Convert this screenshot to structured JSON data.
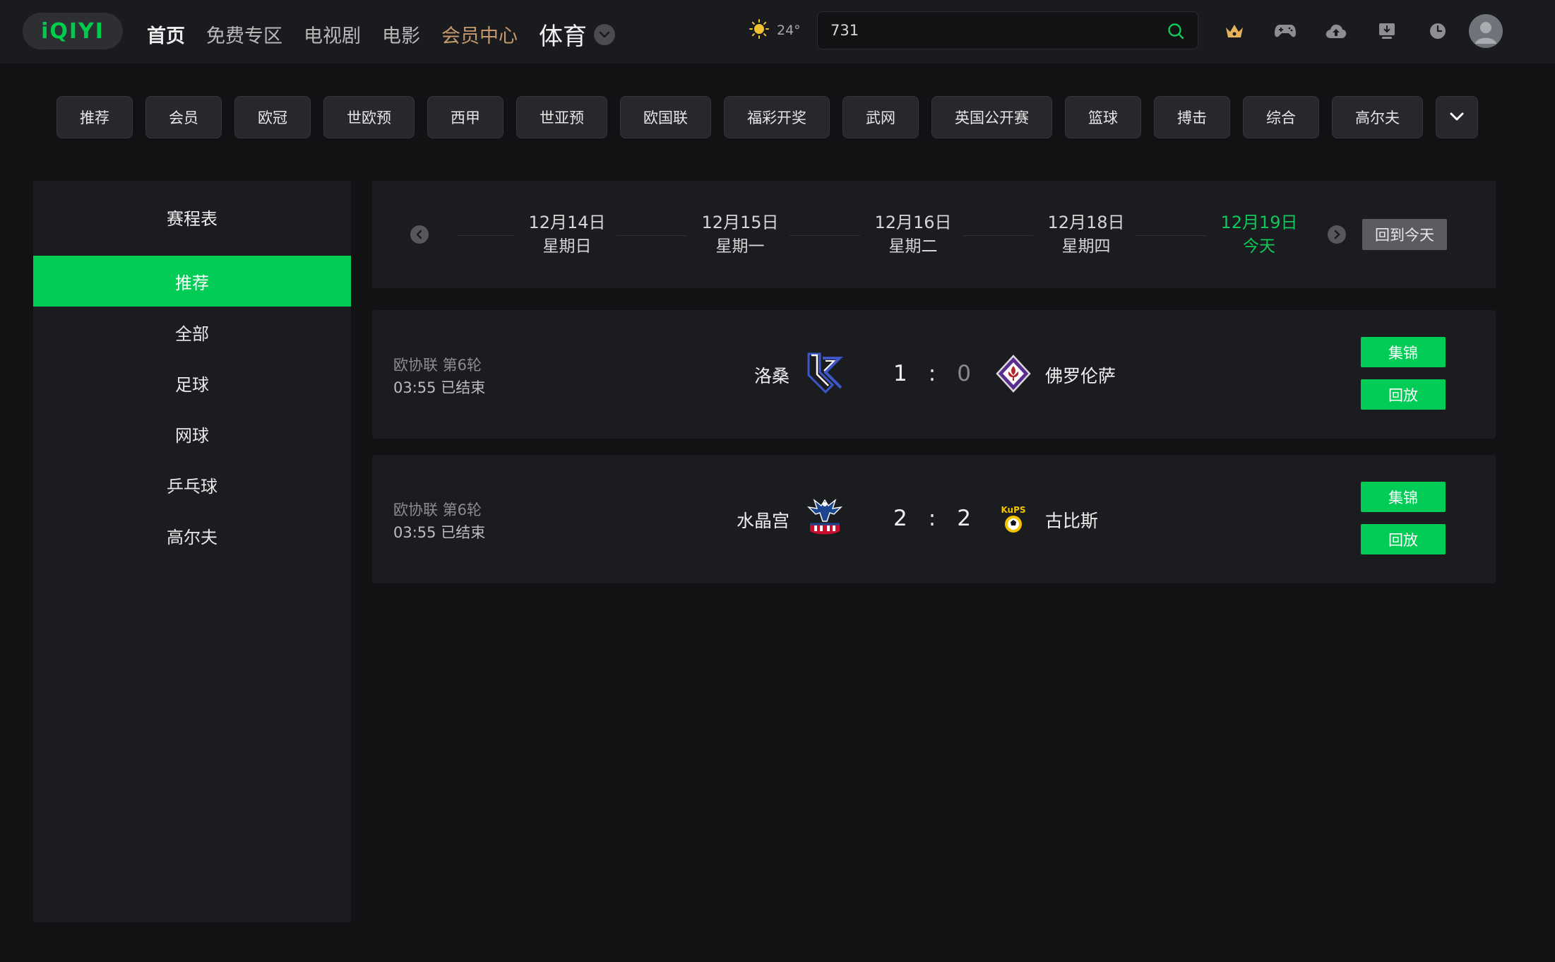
{
  "header": {
    "logo_text": "iQIYI",
    "nav": [
      {
        "label": "首页"
      },
      {
        "label": "免费专区"
      },
      {
        "label": "电视剧"
      },
      {
        "label": "电影"
      },
      {
        "label": "会员中心"
      },
      {
        "label": "体育"
      }
    ],
    "weather": {
      "temp": "24°",
      "icon": "sun-icon"
    },
    "search": {
      "value": "731",
      "icon": "search-icon"
    },
    "tool_icons": [
      "vip-crown-icon",
      "gamepad-icon",
      "cloud-upload-icon",
      "download-icon",
      "history-clock-icon"
    ],
    "accent_color": "#00cc56",
    "vip_color": "#c49a6c"
  },
  "categories": [
    "推荐",
    "会员",
    "欧冠",
    "世欧预",
    "西甲",
    "世亚预",
    "欧国联",
    "福彩开奖",
    "武网",
    "英国公开赛",
    "篮球",
    "搏击",
    "综合",
    "高尔夫"
  ],
  "sidebar": {
    "title": "赛程表",
    "items": [
      "推荐",
      "全部",
      "足球",
      "网球",
      "乒乓球",
      "高尔夫"
    ],
    "active_index": 0
  },
  "datebar": {
    "days": [
      {
        "date": "12月14日",
        "weekday": "星期日"
      },
      {
        "date": "12月15日",
        "weekday": "星期一"
      },
      {
        "date": "12月16日",
        "weekday": "星期二"
      },
      {
        "date": "12月18日",
        "weekday": "星期四"
      },
      {
        "date": "12月19日",
        "weekday": "今天"
      }
    ],
    "today_index": 4,
    "back_to_today": "回到今天"
  },
  "matches": [
    {
      "league": "欧协联 第6轮",
      "status": "03:55 已结束",
      "home": "洛桑",
      "home_score": "1",
      "away_score": "0",
      "away": "佛罗伦萨",
      "highlights": "集锦",
      "replay": "回放"
    },
    {
      "league": "欧协联 第6轮",
      "status": "03:55 已结束",
      "home": "水晶宫",
      "home_score": "2",
      "away_score": "2",
      "away": "古比斯",
      "highlights": "集锦",
      "replay": "回放"
    }
  ],
  "score_separator": ":",
  "kups_logo_text": "KuPS"
}
